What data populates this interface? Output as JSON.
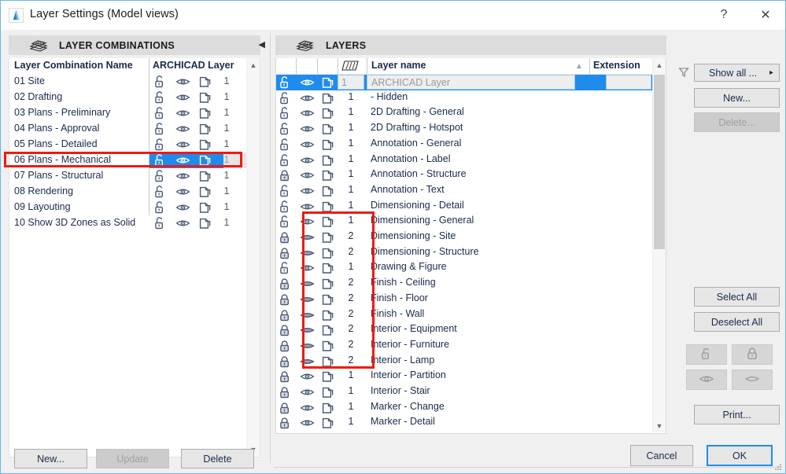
{
  "window": {
    "title": "Layer Settings (Model views)",
    "app_icon": "archicad-logo-icon",
    "help_label": "?",
    "close_label": "✕"
  },
  "left_panel": {
    "header": {
      "icon": "layer-combinations-icon",
      "label": "LAYER COMBINATIONS"
    },
    "collapse_arrow": "◀",
    "columns": [
      "Layer Combination Name",
      "ARCHICAD Layer"
    ],
    "rows": [
      {
        "name": "01 Site",
        "lock": "unlocked",
        "eye": "open",
        "wire": "wireframe",
        "num": "1",
        "selected": false
      },
      {
        "name": "02 Drafting",
        "lock": "unlocked",
        "eye": "open",
        "wire": "wireframe",
        "num": "1",
        "selected": false
      },
      {
        "name": "03 Plans - Preliminary",
        "lock": "unlocked",
        "eye": "open",
        "wire": "wireframe",
        "num": "1",
        "selected": false
      },
      {
        "name": "04 Plans - Approval",
        "lock": "unlocked",
        "eye": "open",
        "wire": "wireframe",
        "num": "1",
        "selected": false
      },
      {
        "name": "05 Plans - Detailed",
        "lock": "unlocked",
        "eye": "open",
        "wire": "wireframe",
        "num": "1",
        "selected": false
      },
      {
        "name": "06 Plans - Mechanical",
        "lock": "unlocked",
        "eye": "open",
        "wire": "wireframe",
        "num": "1",
        "selected": true
      },
      {
        "name": "07 Plans - Structural",
        "lock": "unlocked",
        "eye": "open",
        "wire": "wireframe",
        "num": "1",
        "selected": false
      },
      {
        "name": "08 Rendering",
        "lock": "unlocked",
        "eye": "open",
        "wire": "wireframe",
        "num": "1",
        "selected": false
      },
      {
        "name": "09 Layouting",
        "lock": "unlocked",
        "eye": "open",
        "wire": "wireframe",
        "num": "1",
        "selected": false
      },
      {
        "name": "10 Show 3D Zones as Solid",
        "lock": "unlocked",
        "eye": "open",
        "wire": "wireframe",
        "num": "1",
        "selected": false
      }
    ],
    "buttons": {
      "new": "New...",
      "update": "Update",
      "delete": "Delete"
    }
  },
  "right_panel": {
    "header": {
      "icon": "layers-stack-icon",
      "label": "LAYERS"
    },
    "columns": {
      "lock": "",
      "eye": "",
      "wire": "",
      "intersection": "intersection-group-icon",
      "layer_name": "Layer name",
      "sort_indicator": "▲",
      "extension": "Extension"
    },
    "rows": [
      {
        "lock": "unlocked",
        "eye": "open",
        "wire": "wireframe",
        "num": "1",
        "name": "ARCHICAD Layer",
        "selected": true
      },
      {
        "lock": "unlocked",
        "eye": "open",
        "wire": "wireframe",
        "num": "1",
        "name": "- Hidden",
        "selected": false
      },
      {
        "lock": "unlocked",
        "eye": "open",
        "wire": "wireframe",
        "num": "1",
        "name": "2D Drafting - General",
        "selected": false
      },
      {
        "lock": "unlocked",
        "eye": "open",
        "wire": "wireframe",
        "num": "1",
        "name": "2D Drafting - Hotspot",
        "selected": false
      },
      {
        "lock": "unlocked",
        "eye": "open",
        "wire": "wireframe",
        "num": "1",
        "name": "Annotation - General",
        "selected": false
      },
      {
        "lock": "unlocked",
        "eye": "open",
        "wire": "wireframe",
        "num": "1",
        "name": "Annotation - Label",
        "selected": false
      },
      {
        "lock": "locked",
        "eye": "open",
        "wire": "wireframe",
        "num": "1",
        "name": "Annotation - Structure",
        "selected": false
      },
      {
        "lock": "unlocked",
        "eye": "open",
        "wire": "wireframe",
        "num": "1",
        "name": "Annotation - Text",
        "selected": false
      },
      {
        "lock": "unlocked",
        "eye": "open",
        "wire": "wireframe",
        "num": "1",
        "name": "Dimensioning - Detail",
        "selected": false
      },
      {
        "lock": "unlocked",
        "eye": "open",
        "wire": "wireframe",
        "num": "1",
        "name": "Dimensioning - General",
        "selected": false
      },
      {
        "lock": "locked",
        "eye": "closed",
        "wire": "wireframe",
        "num": "2",
        "name": "Dimensioning - Site",
        "selected": false
      },
      {
        "lock": "locked",
        "eye": "closed",
        "wire": "wireframe",
        "num": "2",
        "name": "Dimensioning - Structure",
        "selected": false
      },
      {
        "lock": "unlocked",
        "eye": "open",
        "wire": "wireframe",
        "num": "1",
        "name": "Drawing & Figure",
        "selected": false
      },
      {
        "lock": "locked",
        "eye": "closed",
        "wire": "wireframe",
        "num": "2",
        "name": "Finish - Ceiling",
        "selected": false
      },
      {
        "lock": "locked",
        "eye": "closed",
        "wire": "wireframe",
        "num": "2",
        "name": "Finish - Floor",
        "selected": false
      },
      {
        "lock": "locked",
        "eye": "closed",
        "wire": "wireframe",
        "num": "2",
        "name": "Finish - Wall",
        "selected": false
      },
      {
        "lock": "locked",
        "eye": "closed",
        "wire": "wireframe",
        "num": "2",
        "name": "Interior - Equipment",
        "selected": false
      },
      {
        "lock": "locked",
        "eye": "closed",
        "wire": "wireframe",
        "num": "2",
        "name": "Interior - Furniture",
        "selected": false
      },
      {
        "lock": "locked",
        "eye": "closed",
        "wire": "wireframe",
        "num": "2",
        "name": "Interior - Lamp",
        "selected": false
      },
      {
        "lock": "locked",
        "eye": "open",
        "wire": "wireframe",
        "num": "1",
        "name": "Interior - Partition",
        "selected": false
      },
      {
        "lock": "locked",
        "eye": "open",
        "wire": "wireframe",
        "num": "1",
        "name": "Interior - Stair",
        "selected": false
      },
      {
        "lock": "locked",
        "eye": "open",
        "wire": "wireframe",
        "num": "1",
        "name": "Marker - Change",
        "selected": false
      },
      {
        "lock": "locked",
        "eye": "open",
        "wire": "wireframe",
        "num": "1",
        "name": "Marker - Detail",
        "selected": false
      }
    ],
    "buttons": {
      "filter_icon": "funnel-filter-icon",
      "show_all": "Show all ...",
      "show_all_arrow": "▸",
      "new": "New...",
      "delete": "Delete...",
      "select_all": "Select All",
      "deselect_all": "Deselect All",
      "unlock_icon": "unlock-icon",
      "lock_icon": "lock-icon",
      "show_icon": "eye-open-icon",
      "hide_icon": "eye-closed-icon",
      "print": "Print..."
    }
  },
  "dialog_buttons": {
    "cancel": "Cancel",
    "ok": "OK"
  },
  "annotations": {
    "highlight_color": "#ee1b13",
    "boxes": [
      {
        "name": "left-selected-row-highlight"
      },
      {
        "name": "layer-visibility-column-highlight"
      }
    ]
  },
  "colors": {
    "selection_blue": "#1f8ced",
    "window_border": "#6cb4e4",
    "panel_bg": "#f0f0f0",
    "header_bg": "#dcdcdc",
    "text": "#1b2a4a"
  }
}
